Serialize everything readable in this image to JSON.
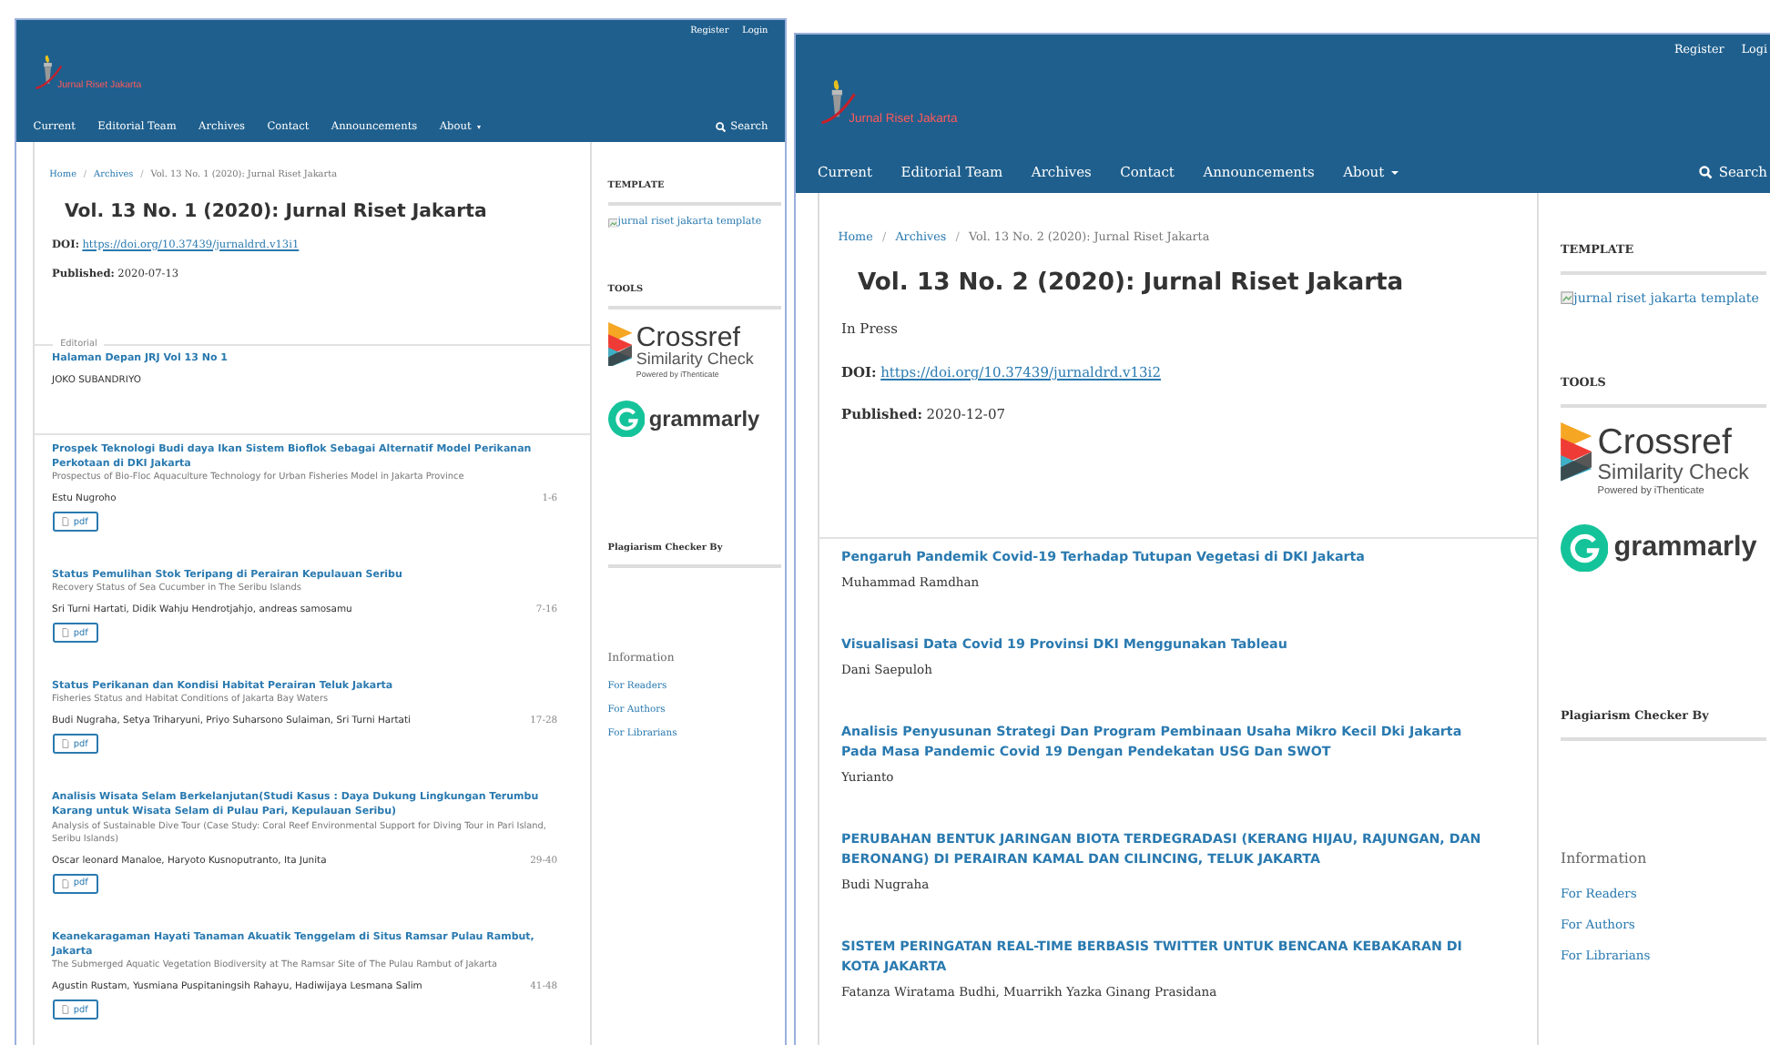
{
  "panels": [
    {
      "header": {
        "user_links": [
          "Register",
          "Login"
        ],
        "logo_text": "Jurnal Riset Jakarta"
      },
      "nav": [
        {
          "label": "Current",
          "has_menu": false
        },
        {
          "label": "Editorial Team",
          "has_menu": false
        },
        {
          "label": "Archives",
          "has_menu": false
        },
        {
          "label": "Contact",
          "has_menu": false
        },
        {
          "label": "Announcements",
          "has_menu": false
        },
        {
          "label": "About",
          "has_menu": true
        }
      ],
      "search": "Search",
      "breadcrumb": {
        "separator": "/",
        "items": [
          {
            "label": "Home",
            "current": false
          },
          {
            "label": "Archives",
            "current": false
          },
          {
            "label": "Vol. 13 No. 1 (2020): Jurnal Riset Jakarta",
            "current": true
          }
        ]
      },
      "title": "Vol. 13 No. 1 (2020): Jurnal Riset Jakarta",
      "doi": {
        "label": "DOI:",
        "url": "https://doi.org/10.37439/jurnaldrd.v13i1"
      },
      "published": {
        "label": "Published:",
        "date": "2020-07-13"
      },
      "sections": [
        {
          "heading": "Editorial",
          "articles": [
            {
              "title": "Halaman Depan JRJ Vol 13 No 1",
              "authors": "JOKO SUBANDRIYO"
            }
          ]
        },
        {
          "articles": [
            {
              "title": "Prospek Teknologi Budi daya Ikan Sistem Bioflok Sebagai Alternatif Model Perikanan Perkotaan di DKI Jakarta",
              "subtitle": "Prospectus of Bio-Floc Aquaculture Technology for Urban Fisheries Model in Jakarta Province",
              "authors": "Estu Nugroho",
              "pages": "1-6",
              "galley": "pdf"
            },
            {
              "title": "Status Pemulihan Stok Teripang di Perairan Kepulauan Seribu",
              "subtitle": "Recovery Status of Sea Cucumber in The Seribu Islands",
              "authors": "Sri Turni Hartati, Didik Wahju Hendrotjahjo, andreas samosamu",
              "pages": "7-16",
              "galley": "pdf"
            },
            {
              "title": "Status Perikanan dan Kondisi Habitat Perairan Teluk Jakarta",
              "subtitle": "Fisheries Status and Habitat Conditions of Jakarta Bay Waters",
              "authors": "Budi Nugraha, Setya Triharyuni, Priyo Suharsono Sulaiman, Sri Turni Hartati",
              "pages": "17-28",
              "galley": "pdf"
            },
            {
              "title": "Analisis Wisata Selam Berkelanjutan(Studi Kasus : Daya Dukung Lingkungan Terumbu Karang untuk Wisata Selam di Pulau Pari, Kepulauan Seribu)",
              "subtitle": "Analysis of Sustainable Dive Tour (Case Study: Coral Reef Environmental Support for Diving Tour in Pari Island, Seribu Islands)",
              "authors": "Oscar leonard Manaloe, Haryoto Kusnoputranto, Ita Junita",
              "pages": "29-40",
              "galley": "pdf"
            },
            {
              "title": "Keanekaragaman Hayati Tanaman Akuatik Tenggelam di Situs Ramsar Pulau Rambut, Jakarta",
              "subtitle": "The Submerged Aquatic Vegetation Biodiversity at The Ramsar Site of The Pulau Rambut of Jakarta",
              "authors": "Agustin Rustam, Yusmiana Puspitaningsih Rahayu, Hadiwijaya Lesmana Salim",
              "pages": "41-48",
              "galley": "pdf"
            }
          ]
        }
      ],
      "sidebar": {
        "template_heading": "TEMPLATE",
        "template_image_alt": "jurnal riset jakarta template",
        "tools_heading": "TOOLS",
        "crossref": {
          "name": "Crossref",
          "product": "Similarity Check",
          "powered": "Powered by iThenticate"
        },
        "grammarly": "grammarly",
        "plagiarism_heading": "Plagiarism Checker By",
        "info_heading": "Information",
        "info_links": [
          "For Readers",
          "For Authors",
          "For Librarians"
        ]
      }
    },
    {
      "header": {
        "user_links": [
          "Register",
          "Logi"
        ],
        "logo_text": "Jurnal Riset Jakarta"
      },
      "nav": [
        {
          "label": "Current",
          "has_menu": false
        },
        {
          "label": "Editorial Team",
          "has_menu": false
        },
        {
          "label": "Archives",
          "has_menu": false
        },
        {
          "label": "Contact",
          "has_menu": false
        },
        {
          "label": "Announcements",
          "has_menu": false
        },
        {
          "label": "About",
          "has_menu": true
        }
      ],
      "search": "Search",
      "breadcrumb": {
        "separator": "/",
        "items": [
          {
            "label": "Home",
            "current": false
          },
          {
            "label": "Archives",
            "current": false
          },
          {
            "label": "Vol. 13 No. 2 (2020): Jurnal Riset Jakarta",
            "current": true
          }
        ]
      },
      "title": "Vol. 13 No. 2 (2020): Jurnal Riset Jakarta",
      "note": "In Press",
      "doi": {
        "label": "DOI:",
        "url": "https://doi.org/10.37439/jurnaldrd.v13i2"
      },
      "published": {
        "label": "Published:",
        "date": "2020-12-07"
      },
      "sections": [
        {
          "articles": [
            {
              "title": "Pengaruh Pandemik Covid-19 Terhadap Tutupan Vegetasi di DKI Jakarta",
              "authors": "Muhammad Ramdhan"
            },
            {
              "title": "Visualisasi Data Covid 19 Provinsi DKI Menggunakan Tableau",
              "authors": "Dani Saepuloh"
            },
            {
              "title": "Analisis Penyusunan Strategi Dan Program Pembinaan Usaha Mikro Kecil Dki Jakarta Pada Masa Pandemic Covid 19 Dengan Pendekatan USG Dan SWOT",
              "authors": "Yurianto"
            },
            {
              "title": "PERUBAHAN BENTUK JARINGAN BIOTA TERDEGRADASI (KERANG HIJAU, RAJUNGAN, DAN BERONANG) DI PERAIRAN KAMAL DAN CILINCING, TELUK JAKARTA",
              "authors": "Budi Nugraha"
            },
            {
              "title": "SISTEM PERINGATAN REAL-TIME BERBASIS TWITTER UNTUK BENCANA KEBAKARAN DI KOTA JAKARTA",
              "authors": "Fatanza Wiratama Budhi, Muarrikh Yazka Ginang Prasidana"
            }
          ]
        }
      ],
      "sidebar": {
        "template_heading": "TEMPLATE",
        "template_image_alt": "jurnal riset jakarta template",
        "tools_heading": "TOOLS",
        "crossref": {
          "name": "Crossref",
          "product": "Similarity Check",
          "powered": "Powered by iThenticate"
        },
        "grammarly": "grammarly",
        "plagiarism_heading": "Plagiarism Checker By",
        "info_heading": "Information",
        "info_links": [
          "For Readers",
          "For Authors",
          "For Librarians"
        ]
      }
    }
  ]
}
